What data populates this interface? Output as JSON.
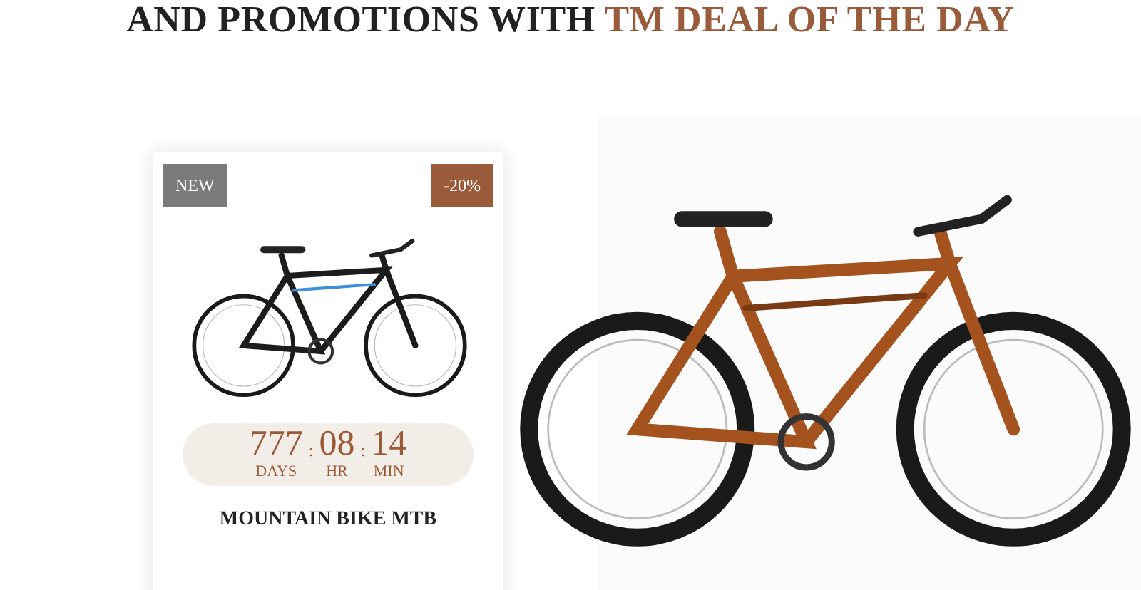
{
  "heading": {
    "text": "AND PROMOTIONS WITH",
    "highlight": "TM DEAL OF THE DAY"
  },
  "product_card": {
    "badges": [
      {
        "kind": "new",
        "label": "NEW"
      },
      {
        "kind": "discount",
        "label": "-20%"
      }
    ],
    "countdown": [
      {
        "value": "777",
        "label": "DAYS"
      },
      {
        "value": "08",
        "label": "HR"
      },
      {
        "value": "14",
        "label": "MIN"
      }
    ],
    "separator": ":",
    "title": "MOUNTAIN BIKE MTB"
  }
}
